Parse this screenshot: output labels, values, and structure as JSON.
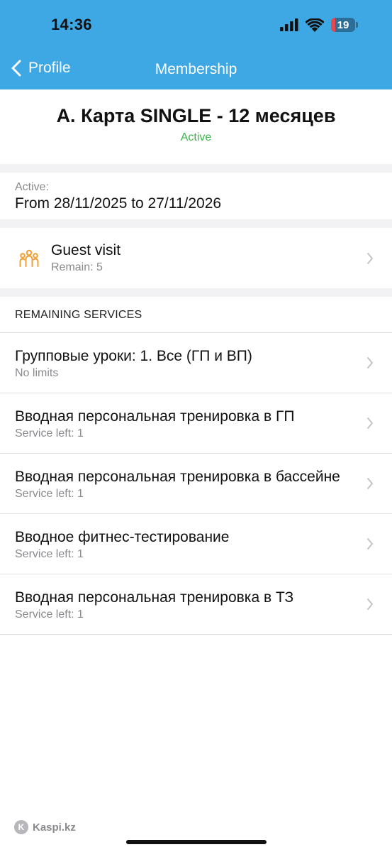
{
  "status_bar": {
    "time": "14:36",
    "battery": "19",
    "battery_level": 0.19,
    "icons": [
      "cellular-signal-icon",
      "wifi-icon",
      "battery-icon"
    ]
  },
  "nav": {
    "back_label": "Profile",
    "title": "Membership"
  },
  "membership": {
    "title": "A. Карта SINGLE - 12 месяцев",
    "status": "Active"
  },
  "period": {
    "label": "Active:",
    "value": "From 28/11/2025 to 27/11/2026"
  },
  "guest_visit": {
    "title": "Guest visit",
    "subtitle": "Remain: 5",
    "icon": "group-icon"
  },
  "remaining_services": {
    "heading": "REMAINING SERVICES",
    "items": [
      {
        "title": "Групповые уроки: 1. Все (ГП и ВП)",
        "subtitle": "No limits"
      },
      {
        "title": "Вводная персональная тренировка в ГП",
        "subtitle": "Service left: 1"
      },
      {
        "title": "Вводная персональная тренировка в бассейне",
        "subtitle": "Service left: 1"
      },
      {
        "title": "Вводное фитнес-тестирование",
        "subtitle": "Service left: 1"
      },
      {
        "title": "Вводная персональная тренировка в ТЗ",
        "subtitle": "Service left: 1"
      }
    ]
  },
  "watermark": {
    "text": "Kaspi.kz"
  },
  "colors": {
    "nav_bar": "#3ea8e5",
    "active_status": "#3bb54a",
    "guest_icon": "#f0a033",
    "secondary_text": "#8a8a8e",
    "section_gap": "#f2f2f4"
  }
}
